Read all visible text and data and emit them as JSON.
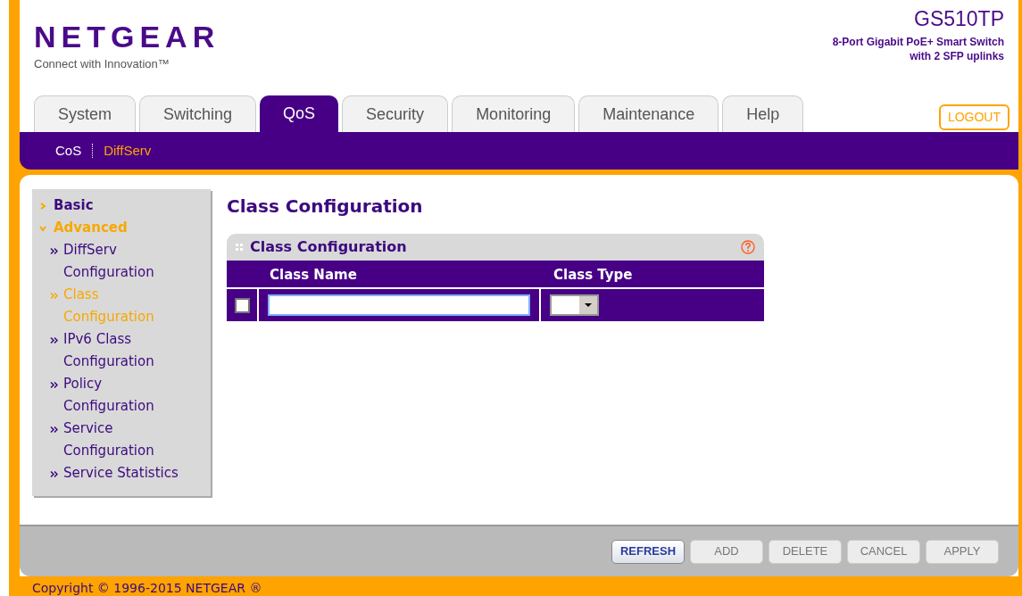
{
  "brand": {
    "logo": "NETGEAR",
    "tagline": "Connect with Innovation™",
    "model": "GS510TP",
    "description": [
      "8-Port Gigabit PoE+ Smart Switch",
      "with 2 SFP uplinks"
    ]
  },
  "tabs": [
    {
      "label": "System",
      "selected": false
    },
    {
      "label": "Switching",
      "selected": false
    },
    {
      "label": "QoS",
      "selected": true
    },
    {
      "label": "Security",
      "selected": false
    },
    {
      "label": "Monitoring",
      "selected": false
    },
    {
      "label": "Maintenance",
      "selected": false
    },
    {
      "label": "Help",
      "selected": false
    }
  ],
  "logout": "LOGOUT",
  "subnav": [
    {
      "label": "CoS",
      "selected": false
    },
    {
      "label": "DiffServ",
      "selected": true
    }
  ],
  "sidebar": {
    "items": [
      {
        "label": "Basic",
        "selected": false,
        "expanded": false
      },
      {
        "label": "Advanced",
        "selected": true,
        "expanded": true,
        "children": [
          {
            "label": "DiffServ Configuration",
            "selected": false
          },
          {
            "label": "Class Configuration",
            "selected": true
          },
          {
            "label": "IPv6 Class Configuration",
            "selected": false
          },
          {
            "label": "Policy Configuration",
            "selected": false
          },
          {
            "label": "Service Configuration",
            "selected": false
          },
          {
            "label": "Service Statistics",
            "selected": false
          }
        ]
      }
    ]
  },
  "page_title": "Class Configuration",
  "panel": {
    "title": "Class Configuration",
    "columns": [
      "Class Name",
      "Class Type"
    ],
    "row": {
      "checked": false
    }
  },
  "buttons": [
    {
      "label": "REFRESH",
      "disabled": false
    },
    {
      "label": "ADD",
      "disabled": true
    },
    {
      "label": "DELETE",
      "disabled": true
    },
    {
      "label": "CANCEL",
      "disabled": true
    },
    {
      "label": "APPLY",
      "disabled": true
    }
  ],
  "copyright": "Copyright © 1996-2015 NETGEAR ®"
}
